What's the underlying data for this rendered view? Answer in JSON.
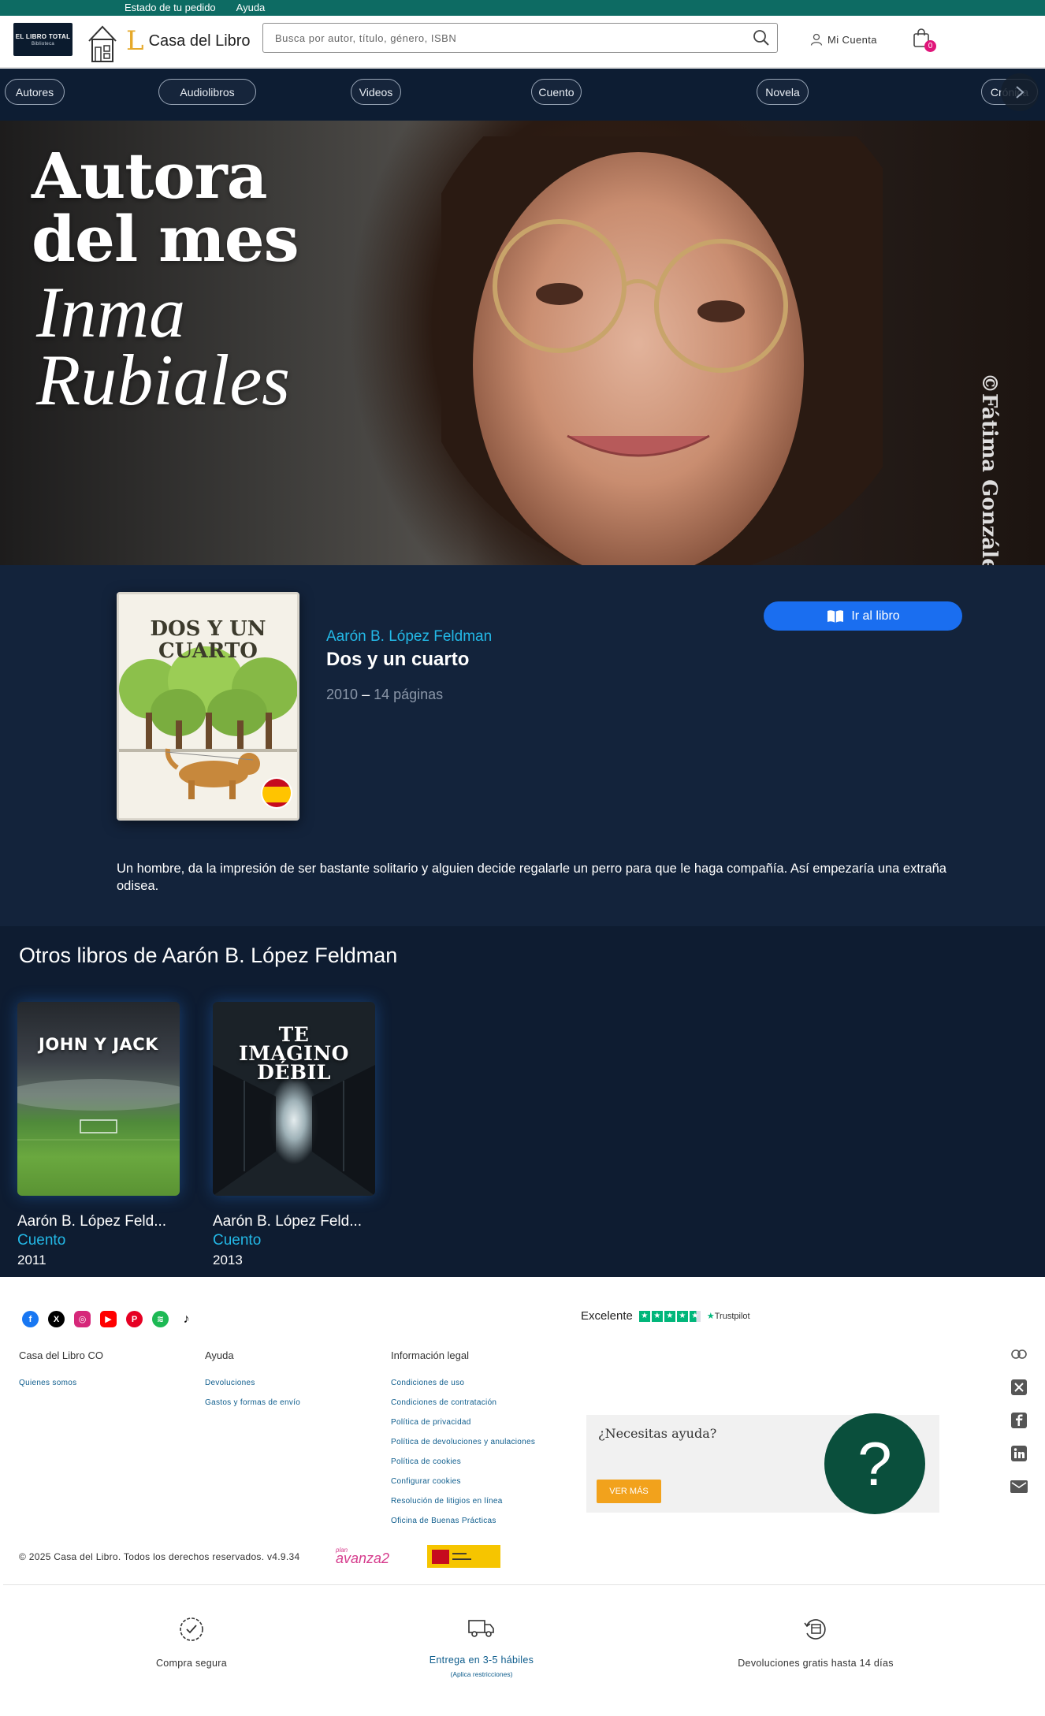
{
  "topbar": {
    "order_status": "Estado de tu pedido",
    "help": "Ayuda"
  },
  "header": {
    "libro_total_logo": "EL LIBRO TOTAL",
    "libro_total_sub": "Biblioteca",
    "brand_name": "Casa del Libro",
    "brand_small": "del",
    "search_placeholder": "Busca por autor, título, género, ISBN",
    "account_label": "Mi Cuenta",
    "cart_count": "0"
  },
  "categories": [
    "Autores",
    "Audiolibros",
    "Videos",
    "Cuento",
    "Novela",
    "Crónica"
  ],
  "hero": {
    "title_line1": "Autora",
    "title_line2": "del mes",
    "name_line1": "Inma",
    "name_line2": "Rubiales",
    "photo_credit": "©Fátima González"
  },
  "book": {
    "cover_title": "DOS Y UN CUARTO",
    "author": "Aarón B. López Feldman",
    "title": "Dos y un cuarto",
    "year": "2010",
    "separator": "–",
    "pages": "14 páginas",
    "goto_label": "Ir al libro",
    "description": "Un hombre, da la impresión de ser bastante solitario y alguien decide regalarle un perro para que le haga compañía. Así empezaría una extraña odisea."
  },
  "others": {
    "heading": "Otros libros de Aarón B. López Feldman",
    "books": [
      {
        "cover_title": "JOHN Y JACK",
        "author": "Aarón B. López Feld...",
        "genre": "Cuento",
        "year": "2011"
      },
      {
        "cover_title": "TE IMAGINO DÉBIL",
        "author": "Aarón B. López Feld...",
        "genre": "Cuento",
        "year": "2013"
      }
    ]
  },
  "footer": {
    "trustpilot_rating": "Excelente",
    "trustpilot_brand": "Trustpilot",
    "col1_title": "Casa del Libro CO",
    "col1_links": [
      "Quienes somos"
    ],
    "col2_title": "Ayuda",
    "col2_links": [
      "Devoluciones",
      "Gastos y formas de envío"
    ],
    "col3_title": "Información legal",
    "col3_links": [
      "Condiciones de uso",
      "Condiciones de contratación",
      "Política de privacidad",
      "Política de devoluciones y anulaciones",
      "Política de cookies",
      "Configurar cookies",
      "Resolución de litigios en línea",
      "Oficina de Buenas Prácticas"
    ],
    "help_question": "¿Necesitas ayuda?",
    "help_button": "VER MÁS",
    "help_symbol": "?",
    "copyright": "© 2025 Casa del Libro. Todos los derechos reservados. v4.9.34",
    "avanza_top": "plan",
    "avanza": "avanza2",
    "benefits": [
      {
        "label": "Compra segura",
        "note": ""
      },
      {
        "label": "Entrega en 3-5 hábiles",
        "note": "(Aplica restricciones)"
      },
      {
        "label": "Devoluciones gratis hasta 14 días",
        "note": ""
      }
    ]
  },
  "colors": {
    "top_strip": "#0d6b63",
    "nav_bg": "#0d1d33",
    "detail_bg": "#13233b",
    "accent_blue": "#1a6ef0",
    "author_cyan": "#23b8e6",
    "cart_badge": "#e0157a",
    "help_green": "#0a4f3c",
    "help_orange": "#f2a21c"
  }
}
